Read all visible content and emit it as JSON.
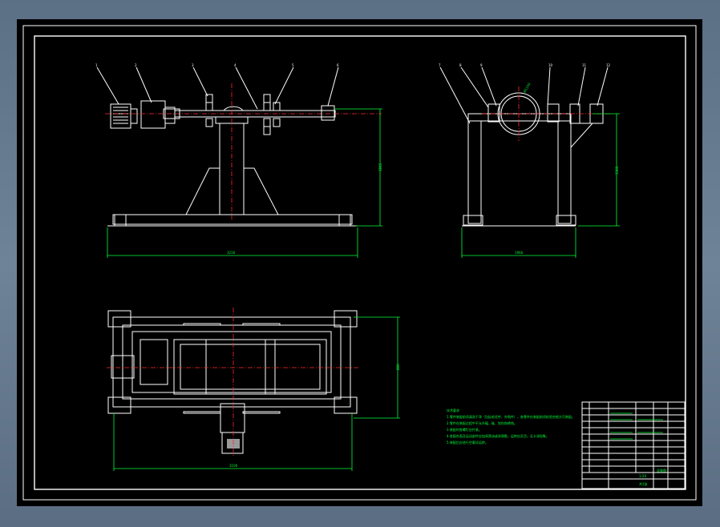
{
  "drawing": {
    "background_color": "#000000",
    "line_color": "#ffffff",
    "centerline_color": "#ff2a2a",
    "dimension_color": "#00ff3a"
  },
  "front_view": {
    "balloons": [
      "1",
      "2",
      "3",
      "4",
      "5",
      "6"
    ],
    "dim_height": "1845",
    "dim_width": "3216"
  },
  "side_view": {
    "balloons": [
      "7",
      "8",
      "9",
      "10",
      "11",
      "12"
    ],
    "dim_height": "1360",
    "dim_width": "1960",
    "dim_diameter": "Ø1100"
  },
  "top_view": {
    "dim_height": "880",
    "dim_width": "3100"
  },
  "notes": {
    "title": "技术要求",
    "lines": [
      "1.零件装配前须清洗干净（包括毛坯件、外购件），各零件在装配前须检验合格方可装配。",
      "2.零件在装配过程中不允许磕、碰、划伤和锈蚀。",
      "3.装配时各螺钉应拧紧。",
      "4.各配合面及运动部件应加润滑油或润滑脂，运转应灵活，无卡滞现象。",
      "5.装配后应进行空载试运转。"
    ]
  },
  "title_block": {
    "drawing_name": "总装图",
    "scale": "1:20",
    "sheet": "共1张"
  }
}
